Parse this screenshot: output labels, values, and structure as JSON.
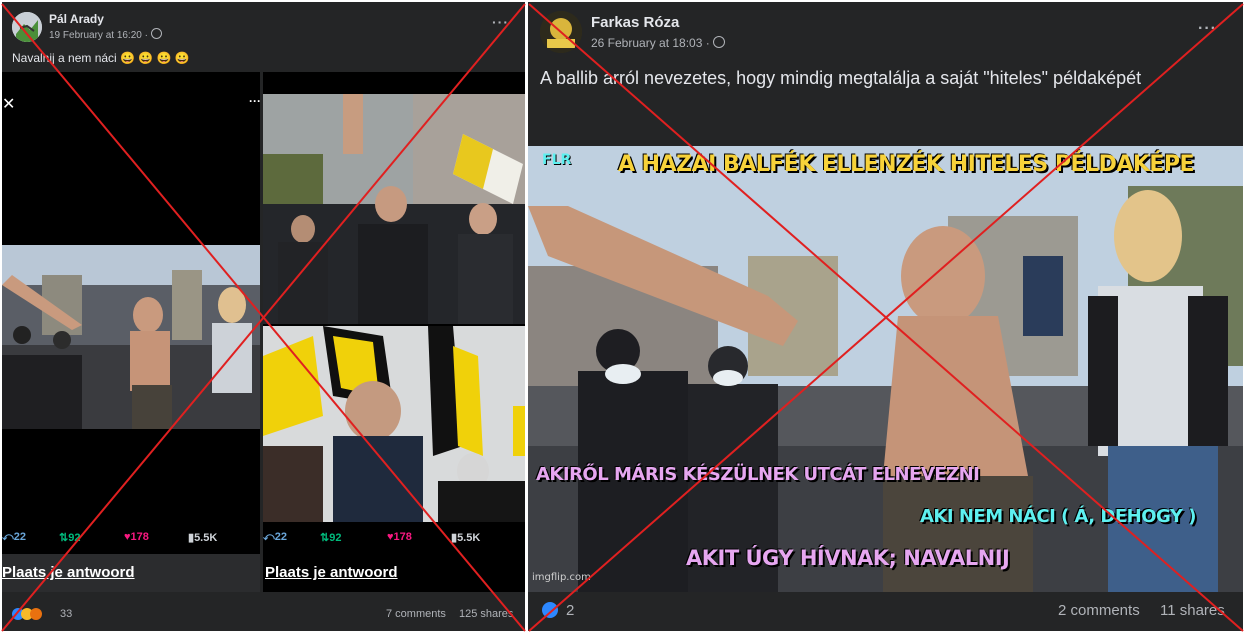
{
  "left_post": {
    "author": "Pál Arady",
    "timestamp": "19 February at 16:20 · ",
    "privacy_icon": "globe-icon",
    "more_label": "···",
    "text": "Navalnij a nem náci 😀 😀 😀 😀",
    "tweets": [
      {
        "close_label": "✕",
        "more_label": "···",
        "replies": "22",
        "retweets": "92",
        "likes": "178",
        "views": "5.5K",
        "reply_prompt": "Plaats je antwoord"
      },
      {
        "close_label": "✕",
        "more_label": "···",
        "replies": "22",
        "retweets": "92",
        "likes": "178",
        "views": "5.5K",
        "reply_prompt": "Plaats je antwoord"
      }
    ],
    "reaction_count": "33",
    "comments": "7 comments",
    "shares": "125 shares"
  },
  "right_post": {
    "author": "Farkas Róza",
    "timestamp": "26 February at 18:03 · ",
    "privacy_icon": "globe-icon",
    "more_label": "···",
    "text": "A ballib arról nevezetes, hogy mindig megtalálja a saját \"hiteles\" példaképét",
    "meme": {
      "tag": "FLR",
      "caption_top": "A HAZAI BALFÉK ELLENZÉK HITELES PÉLDAKÉPE",
      "caption_middle": "AKIRŐL MÁRIS KÉSZÜLNEK UTCÁT ELNEVEZNI",
      "caption_right": "AKI NEM NÁCI ( Á, DEHOGY )",
      "caption_bottom": "AKIT ÚGY HÍVNAK; NAVALNIJ",
      "watermark": "imgflip.com"
    },
    "reaction_count": "2",
    "comments": "2 comments",
    "shares": "11 shares"
  },
  "colors": {
    "panel_bg": "#242526",
    "text_primary": "#e4e6eb",
    "text_secondary": "#b0b3b8",
    "cross_red": "#e02020",
    "meme_yellow": "#f7d23a",
    "meme_pink": "#e6a6f0",
    "meme_cyan": "#5ef0f0",
    "twitter_green": "#00ba7c",
    "twitter_pink": "#f91880"
  }
}
